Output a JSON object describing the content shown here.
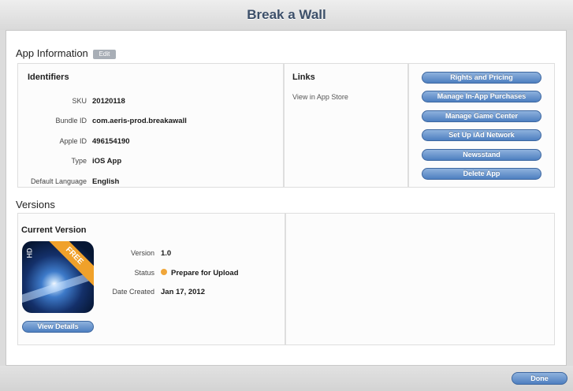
{
  "window": {
    "title": "Break a Wall"
  },
  "app_information": {
    "title": "App Information",
    "edit_label": "Edit",
    "identifiers": {
      "heading": "Identifiers",
      "rows": [
        {
          "label": "SKU",
          "value": "20120118"
        },
        {
          "label": "Bundle ID",
          "value": "com.aeris-prod.breakawall"
        },
        {
          "label": "Apple ID",
          "value": "496154190"
        },
        {
          "label": "Type",
          "value": "iOS App"
        },
        {
          "label": "Default Language",
          "value": "English"
        }
      ]
    },
    "links": {
      "heading": "Links",
      "view_in_app_store": "View in App Store"
    },
    "actions": [
      "Rights and Pricing",
      "Manage In-App Purchases",
      "Manage Game Center",
      "Set Up iAd Network",
      "Newsstand",
      "Delete App"
    ]
  },
  "versions": {
    "title": "Versions",
    "current_version": {
      "heading": "Current Version",
      "icon_badge": "FREE",
      "icon_corner": "HD",
      "rows": [
        {
          "label": "Version",
          "value": "1.0"
        },
        {
          "label": "Status",
          "value": "Prepare for Upload"
        },
        {
          "label": "Date Created",
          "value": "Jan 17, 2012"
        }
      ],
      "view_details_label": "View Details"
    }
  },
  "footer": {
    "done_label": "Done"
  },
  "colors": {
    "button_blue": "#4e7fc0",
    "status_orange": "#f0a63a",
    "title_text": "#3c4f69"
  }
}
